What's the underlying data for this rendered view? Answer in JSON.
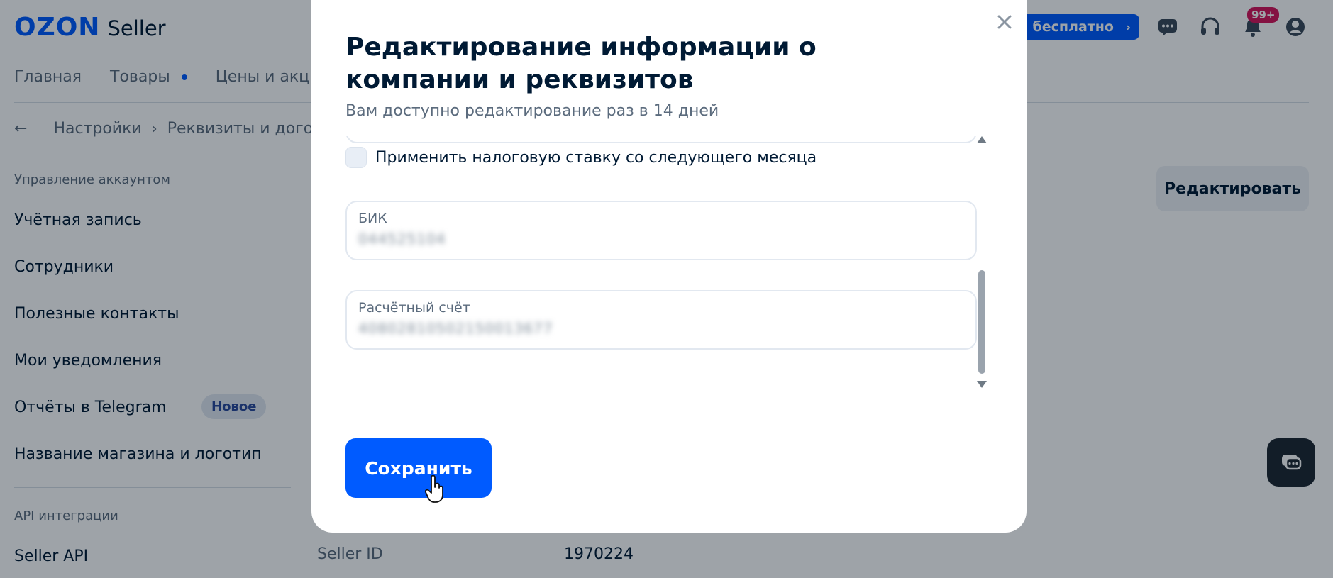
{
  "header": {
    "logo_brand": "OZON",
    "logo_product": "Seller",
    "premium_label": "um бесплатно",
    "notifications_badge": "99+"
  },
  "topnav": {
    "items": [
      "Главная",
      "Товары",
      "Цены и акции"
    ]
  },
  "breadcrumb": {
    "items": [
      "Настройки",
      "Реквизиты и догов"
    ]
  },
  "sidebar": {
    "section_account": "Управление аккаунтом",
    "items": [
      "Учётная запись",
      "Сотрудники",
      "Полезные контакты",
      "Мои уведомления",
      "Отчёты в Telegram",
      "Название магазина и логотип"
    ],
    "new_badge": "Новое",
    "section_api": "API интеграции",
    "api_items": [
      "Seller API"
    ]
  },
  "main": {
    "edit_button": "Редактировать",
    "seller_id_label": "Seller ID",
    "seller_id_value": "1970224"
  },
  "modal": {
    "title": "Редактирование информации о компании и реквизитов",
    "subtitle": "Вам доступно редактирование раз в 14 дней",
    "checkbox_label": "Применить налоговую ставку со следующего месяца",
    "checkbox_checked": false,
    "fields": [
      {
        "label": "БИК",
        "value": "044525104"
      },
      {
        "label": "Расчётный счёт",
        "value": "40802810502150013677"
      }
    ],
    "save_button": "Сохранить"
  },
  "colors": {
    "accent": "#005bff",
    "text_primary": "#001a34",
    "text_secondary": "#5b6b7d",
    "badge": "#d6155b"
  }
}
